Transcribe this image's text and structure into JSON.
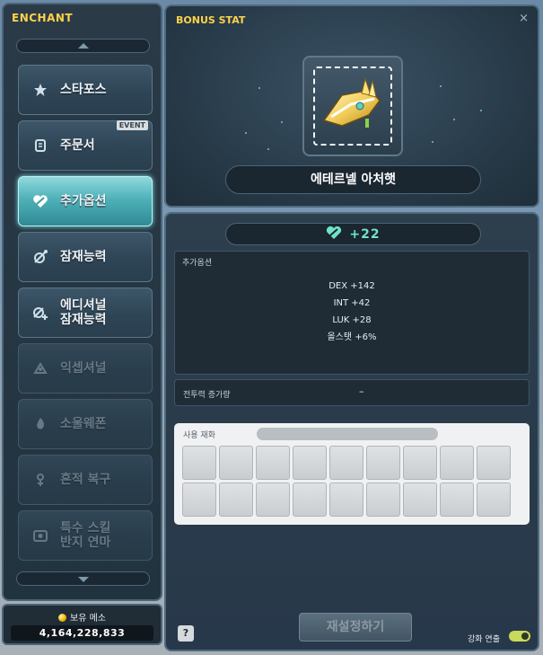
{
  "left_panel": {
    "title": "ENCHANT",
    "menu": [
      {
        "label": "스타포스",
        "icon": "star-icon",
        "state": "normal"
      },
      {
        "label": "주문서",
        "icon": "scroll-icon",
        "state": "normal",
        "badge": "EVENT"
      },
      {
        "label": "추가옵션",
        "icon": "bonus-stat-icon",
        "state": "active"
      },
      {
        "label": "잠재능력",
        "icon": "potential-icon",
        "state": "normal"
      },
      {
        "label": "에디셔널\n잠재능력",
        "icon": "additional-potential-icon",
        "state": "normal"
      },
      {
        "label": "익셉셔널",
        "icon": "exceptional-icon",
        "state": "disabled"
      },
      {
        "label": "소울웨폰",
        "icon": "soul-weapon-icon",
        "state": "disabled"
      },
      {
        "label": "흔적 복구",
        "icon": "trace-restore-icon",
        "state": "disabled"
      },
      {
        "label": "특수 스킬\n반지 연마",
        "icon": "special-ring-icon",
        "state": "disabled"
      }
    ]
  },
  "meso": {
    "label": "보유 메소",
    "value": "4,164,228,833"
  },
  "bonus_stat": {
    "title": "BONUS STAT",
    "close": "×",
    "item_name": "에테르넬 아처햇",
    "stat_value": "+22",
    "options_title": "추가옵션",
    "options": [
      "DEX +142",
      "INT +42",
      "LUK +28",
      "올스탯 +6%"
    ],
    "power_label": "전투력 증가량",
    "power_value": "–",
    "material_label": "사용 재화",
    "reset_button": "재설정하기",
    "help": "?",
    "auto_label": "강화 연출",
    "auto_on": true
  },
  "colors": {
    "title_gold": "#ffd24a",
    "active_teal": "#4fb1b9",
    "stat_green": "#6fe3c6",
    "toggle_on": "#c9d95b"
  }
}
